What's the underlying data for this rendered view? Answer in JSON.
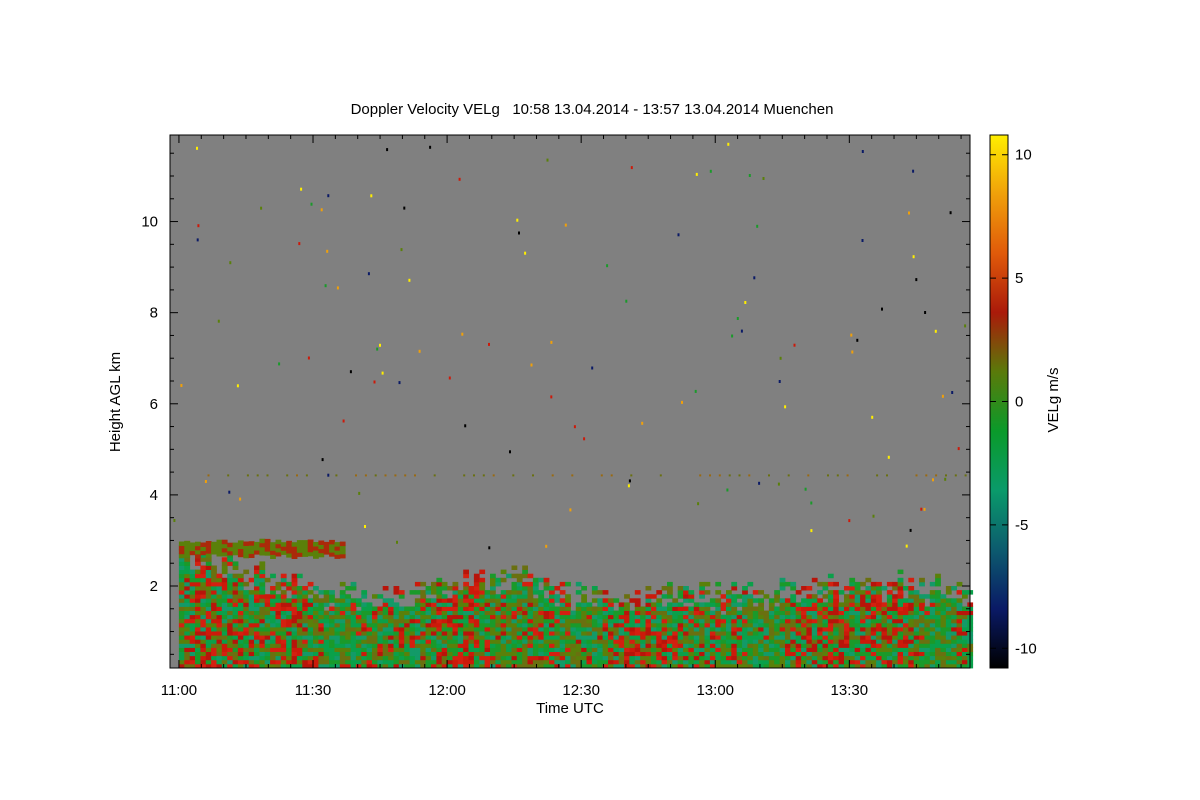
{
  "chart_data": {
    "type": "heatmap",
    "title": "Doppler Velocity VELg   10:58 13.04.2014 - 13:57 13.04.2014 Muenchen",
    "xlabel": "Time UTC",
    "ylabel": "Height AGL km",
    "colorbar_label": "VELg m/s",
    "xlim_minutes_from_midnight": [
      658,
      837
    ],
    "ylim_km": [
      0.2,
      11.9
    ],
    "x_ticks": [
      {
        "value": 660,
        "label": "11:00"
      },
      {
        "value": 690,
        "label": "11:30"
      },
      {
        "value": 720,
        "label": "12:00"
      },
      {
        "value": 750,
        "label": "12:30"
      },
      {
        "value": 780,
        "label": "13:00"
      },
      {
        "value": 810,
        "label": "13:30"
      }
    ],
    "y_ticks": [
      2,
      4,
      6,
      8,
      10
    ],
    "colorbar_range": [
      -10.8,
      10.8
    ],
    "colorbar_ticks": [
      -10,
      -5,
      0,
      5,
      10
    ],
    "colormap": [
      "#000000",
      "#0a1a66",
      "#0c5b6e",
      "#0a9a6a",
      "#0a9a2a",
      "#5a7a0a",
      "#aa1a0a",
      "#e05a0a",
      "#f0a00a",
      "#ffee00"
    ],
    "no_data_color": "#808080",
    "cloud_layer_2_8km_start_min": 660,
    "cloud_layer_2_8km_end_min": 697,
    "boundary_layer_top_km": [
      {
        "t": 660,
        "h": 2.9
      },
      {
        "t": 675,
        "h": 2.4
      },
      {
        "t": 690,
        "h": 2.0
      },
      {
        "t": 705,
        "h": 1.8
      },
      {
        "t": 720,
        "h": 2.2
      },
      {
        "t": 735,
        "h": 2.3
      },
      {
        "t": 750,
        "h": 1.9
      },
      {
        "t": 765,
        "h": 1.9
      },
      {
        "t": 780,
        "h": 1.9
      },
      {
        "t": 795,
        "h": 2.0
      },
      {
        "t": 810,
        "h": 2.2
      },
      {
        "t": 825,
        "h": 2.1
      },
      {
        "t": 837,
        "h": 1.9
      }
    ]
  }
}
